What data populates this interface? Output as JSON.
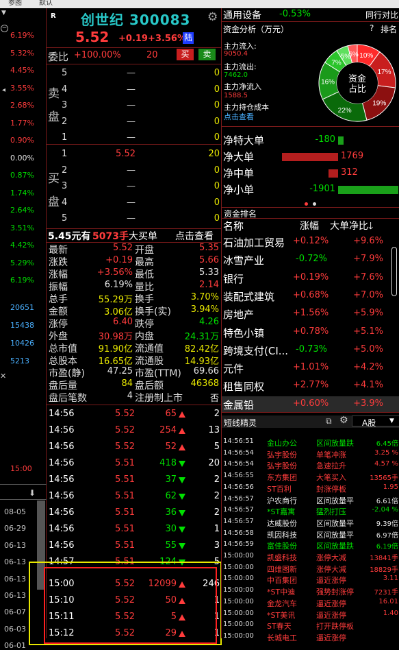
{
  "menubar": {
    "item1": "参图",
    "item2": "默认"
  },
  "left_panel": {
    "pcts": [
      "6.19%",
      "5.32%",
      "4.45%",
      "3.55%",
      "2.68%",
      "1.77%",
      "0.90%",
      "0.00%",
      "0.87%",
      "1.74%",
      "2.64%",
      "3.51%",
      "4.42%",
      "5.29%",
      "6.19%"
    ],
    "vols": [
      "20651",
      "15438",
      "10426",
      "5213"
    ],
    "time": "15:00",
    "dates": [
      "08-05",
      "06-29",
      "06-13",
      "06-13",
      "06-13",
      "06-13",
      "06-07",
      "06-03",
      "06-01"
    ]
  },
  "stock": {
    "flag": "R",
    "name": "创世纪",
    "code": "300083",
    "price": "5.52",
    "change": "+0.19",
    "pct": "+3.56%",
    "tag": "陆"
  },
  "weibi": {
    "label": "委比",
    "ratio": "+100.00%",
    "diff": "20",
    "buy": "买",
    "sell": "卖"
  },
  "sell_label": [
    "卖",
    "盘"
  ],
  "buy_label": [
    "买",
    "盘"
  ],
  "sell_orders": [
    {
      "n": "5",
      "price": "—",
      "vol": "0"
    },
    {
      "n": "4",
      "price": "—",
      "vol": "0"
    },
    {
      "n": "3",
      "price": "—",
      "vol": "0"
    },
    {
      "n": "2",
      "price": "—",
      "vol": "0"
    },
    {
      "n": "1",
      "price": "—",
      "vol": "0"
    }
  ],
  "buy_orders": [
    {
      "n": "1",
      "price": "5.52",
      "vol": "20"
    },
    {
      "n": "2",
      "price": "—",
      "vol": "0"
    },
    {
      "n": "3",
      "price": "—",
      "vol": "0"
    },
    {
      "n": "4",
      "price": "—",
      "vol": "0"
    },
    {
      "n": "5",
      "price": "—",
      "vol": "0"
    }
  ],
  "bigorder": {
    "price": "5.45元有",
    "vol": "5073手",
    "label": "大买单",
    "link": "点击查看"
  },
  "stats": [
    {
      "l1": "最新",
      "v1": "5.52",
      "c1": "red",
      "l2": "开盘",
      "v2": "5.35",
      "c2": "red"
    },
    {
      "l1": "涨跌",
      "v1": "+0.19",
      "c1": "red",
      "l2": "最高",
      "v2": "5.66",
      "c2": "red"
    },
    {
      "l1": "涨幅",
      "v1": "+3.56%",
      "c1": "red",
      "l2": "最低",
      "v2": "5.33",
      "c2": "white"
    },
    {
      "l1": "振幅",
      "v1": "6.19%",
      "c1": "white",
      "l2": "量比",
      "v2": "2.14",
      "c2": "red"
    },
    {
      "l1": "总手",
      "v1": "55.29万",
      "c1": "yellow",
      "l2": "换手",
      "v2": "3.70%",
      "c2": "yellow"
    },
    {
      "l1": "金额",
      "v1": "3.06亿",
      "c1": "yellow",
      "l2": "换手(实)",
      "v2": "3.94%",
      "c2": "yellow"
    },
    {
      "l1": "涨停",
      "v1": "6.40",
      "c1": "red",
      "l2": "跌停",
      "v2": "4.26",
      "c2": "green"
    },
    {
      "l1": "外盘",
      "v1": "30.98万",
      "c1": "red",
      "l2": "内盘",
      "v2": "24.31万",
      "c2": "green"
    },
    {
      "l1": "总市值",
      "v1": "91.90亿",
      "c1": "yellow",
      "l2": "流通值",
      "v2": "82.42亿",
      "c2": "yellow"
    },
    {
      "l1": "总股本",
      "v1": "16.65亿",
      "c1": "yellow",
      "l2": "流通股",
      "v2": "14.93亿",
      "c2": "yellow"
    },
    {
      "l1": "市盈(静)",
      "v1": "47.25",
      "c1": "white",
      "l2": "市盈(TTM)",
      "v2": "69.66",
      "c2": "white"
    },
    {
      "l1": "盘后量",
      "v1": "84",
      "c1": "yellow",
      "l2": "盘后额",
      "v2": "46368",
      "c2": "yellow"
    },
    {
      "l1": "盘后笔数",
      "v1": "4",
      "c1": "white",
      "l2": "注册制上市",
      "v2": "否",
      "c2": "white"
    }
  ],
  "ticks": [
    {
      "t": "14:56",
      "p": "5.52",
      "v": "65",
      "d": "up",
      "n": "2"
    },
    {
      "t": "14:56",
      "p": "5.52",
      "v": "254",
      "d": "up",
      "n": "13"
    },
    {
      "t": "14:56",
      "p": "5.52",
      "v": "52",
      "d": "up",
      "n": "5"
    },
    {
      "t": "14:56",
      "p": "5.51",
      "v": "418",
      "d": "dn",
      "n": "20"
    },
    {
      "t": "14:56",
      "p": "5.51",
      "v": "37",
      "d": "dn",
      "n": "2"
    },
    {
      "t": "14:56",
      "p": "5.51",
      "v": "62",
      "d": "dn",
      "n": "2"
    },
    {
      "t": "14:56",
      "p": "5.51",
      "v": "36",
      "d": "dn",
      "n": "2"
    },
    {
      "t": "14:56",
      "p": "5.51",
      "v": "30",
      "d": "dn",
      "n": "1"
    },
    {
      "t": "14:56",
      "p": "5.51",
      "v": "55",
      "d": "dn",
      "n": "3"
    },
    {
      "t": "14:57",
      "p": "5.51",
      "v": "124",
      "d": "dn",
      "n": "5"
    },
    {
      "t": "15:00",
      "p": "5.52",
      "v": "12099",
      "d": "up",
      "n": "246"
    },
    {
      "t": "15:10",
      "p": "5.52",
      "v": "50",
      "d": "up",
      "n": "1"
    },
    {
      "t": "15:11",
      "p": "5.52",
      "v": "5",
      "d": "up",
      "n": "1"
    },
    {
      "t": "15:12",
      "p": "5.52",
      "v": "29",
      "d": "up",
      "n": "1"
    }
  ],
  "sector": {
    "name": "通用设备",
    "pct": "-0.53%",
    "link": "同行对比"
  },
  "fund": {
    "title": "资金分析（万元）",
    "help": "?",
    "rank": "排名",
    "inflow_label": "主力流入:",
    "inflow": "9050.4",
    "outflow_label": "主力流出:",
    "outflow": "7462.0",
    "net_label": "主力净流入",
    "net": "1588.5",
    "cost_label": "主力持仓成本",
    "cost_link": "点击查看",
    "donut_center": [
      "资金",
      "占比"
    ],
    "donut": [
      {
        "label": "10%",
        "value": 10,
        "color": "#ff2a2a"
      },
      {
        "label": "17%",
        "value": 17,
        "color": "#c81e1e"
      },
      {
        "label": "19%",
        "value": 19,
        "color": "#8c1010"
      },
      {
        "label": "22%",
        "value": 22,
        "color": "#0a6a0a"
      },
      {
        "label": "16%",
        "value": 16,
        "color": "#1a9a1a"
      },
      {
        "label": "7%",
        "value": 7,
        "color": "#2ac42a"
      },
      {
        "label": "5%",
        "value": 5,
        "color": "#5ee05e"
      },
      {
        "label": "5%",
        "value": 4,
        "color": "#ff5a5a"
      }
    ]
  },
  "netflow": [
    {
      "label": "净特大单",
      "value": "-180",
      "bar": -180,
      "color": "green"
    },
    {
      "label": "净大单",
      "value": "1769",
      "bar": 1769,
      "color": "red"
    },
    {
      "label": "净中单",
      "value": "312",
      "bar": 312,
      "color": "red"
    },
    {
      "label": "净小单",
      "value": "-1901",
      "bar": -1901,
      "color": "green"
    }
  ],
  "rank": {
    "title": "资金排名",
    "headers": [
      "名称",
      "涨幅",
      "大单净比"
    ],
    "rows": [
      {
        "name": "石油加工贸易",
        "pct": "+0.12%",
        "ratio": "+9.6%"
      },
      {
        "name": "冰雪产业",
        "pct": "-0.72%",
        "ratio": "+7.9%"
      },
      {
        "name": "银行",
        "pct": "+0.19%",
        "ratio": "+7.6%"
      },
      {
        "name": "装配式建筑",
        "pct": "+0.68%",
        "ratio": "+7.0%"
      },
      {
        "name": "房地产",
        "pct": "+1.56%",
        "ratio": "+5.9%"
      },
      {
        "name": "特色小镇",
        "pct": "+0.78%",
        "ratio": "+5.1%"
      },
      {
        "name": "跨境支付(CI...",
        "pct": "-0.73%",
        "ratio": "+5.0%"
      },
      {
        "name": "元件",
        "pct": "+1.01%",
        "ratio": "+4.2%"
      },
      {
        "name": "租售同权",
        "pct": "+2.77%",
        "ratio": "+4.1%"
      },
      {
        "name": "金属铅",
        "pct": "+0.60%",
        "ratio": "+3.9%"
      }
    ]
  },
  "spirit": {
    "title": "短线精灵",
    "market": "A股",
    "rows": [
      {
        "t": "14:56:51",
        "name": "金山办公",
        "ev": "区间放量跌",
        "val": "6.45倍",
        "ec": "green"
      },
      {
        "t": "14:56:54",
        "name": "弘宇股份",
        "ev": "单笔冲涨",
        "val": "3.25 %",
        "ec": "red"
      },
      {
        "t": "14:56:54",
        "name": "弘宇股份",
        "ev": "急速拉升",
        "val": "4.57 %",
        "ec": "red"
      },
      {
        "t": "14:56:55",
        "name": "东方集团",
        "ev": "大笔买入",
        "val": "13565手",
        "ec": "red"
      },
      {
        "t": "14:56:56",
        "name": "ST百利",
        "ev": "封涨停板",
        "val": "1.95",
        "ec": "red"
      },
      {
        "t": "14:56:57",
        "name": "沪农商行",
        "ev": "区间放量平",
        "val": "6.61倍",
        "ec": "white"
      },
      {
        "t": "14:56:57",
        "name": "*ST嘉寓",
        "ev": "猛烈打压",
        "val": "-2.04 %",
        "ec": "green"
      },
      {
        "t": "14:56:57",
        "name": "达威股份",
        "ev": "区间放量平",
        "val": "9.39倍",
        "ec": "white"
      },
      {
        "t": "14:56:58",
        "name": "凯因科技",
        "ev": "区间放量平",
        "val": "6.97倍",
        "ec": "white"
      },
      {
        "t": "14:56:59",
        "name": "富佳股份",
        "ev": "区间放量跌",
        "val": "6.19倍",
        "ec": "green"
      },
      {
        "t": "15:00:00",
        "name": "凯盛科技",
        "ev": "涨停大减",
        "val": "13841手",
        "ec": "red"
      },
      {
        "t": "15:00:00",
        "name": "四维图新",
        "ev": "涨停大减",
        "val": "18829手",
        "ec": "red"
      },
      {
        "t": "15:00:00",
        "name": "中百集团",
        "ev": "逼近涨停",
        "val": "3.11",
        "ec": "red"
      },
      {
        "t": "15:00:00",
        "name": "*ST中迪",
        "ev": "强势封涨停",
        "val": "7231手",
        "ec": "red"
      },
      {
        "t": "15:00:00",
        "name": "金龙汽车",
        "ev": "逼近涨停",
        "val": "16.01",
        "ec": "red"
      },
      {
        "t": "15:00:00",
        "name": "*ST美讯",
        "ev": "逼近涨停",
        "val": "1.40",
        "ec": "red"
      },
      {
        "t": "15:00:00",
        "name": "ST春天",
        "ev": "打开跌停板",
        "val": "",
        "ec": "red"
      },
      {
        "t": "15:00:00",
        "name": "长城电工",
        "ev": "逼近涨停",
        "val": "",
        "ec": "red"
      }
    ]
  }
}
